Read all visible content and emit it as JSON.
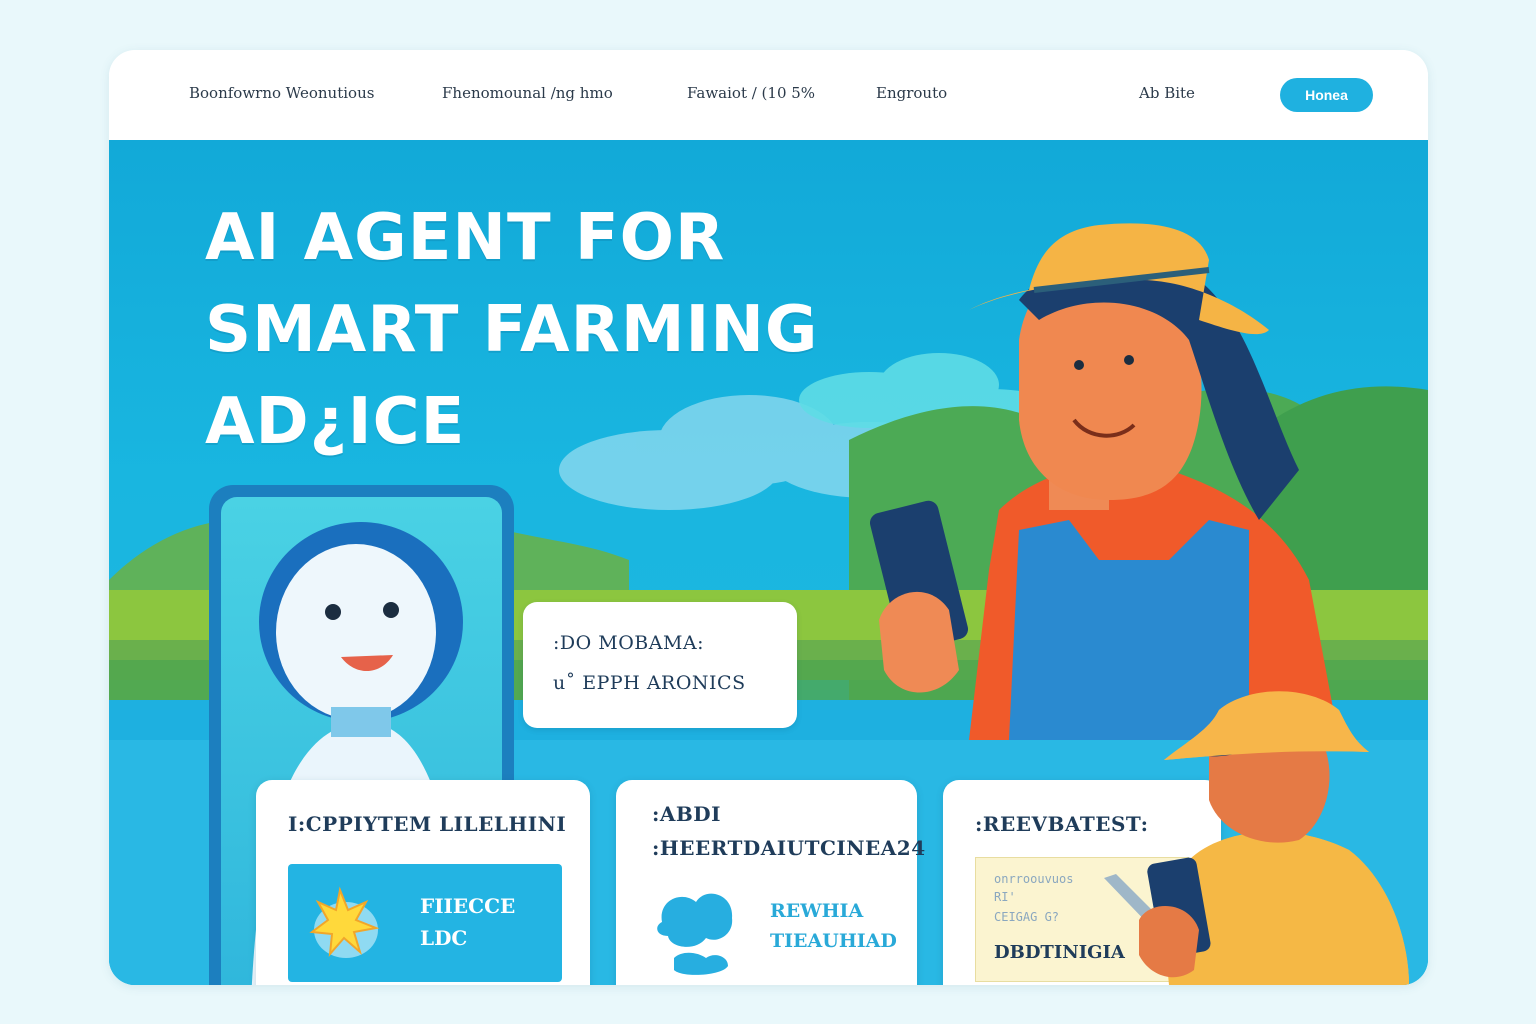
{
  "nav": {
    "links": [
      "Boonfowrno Weonutious",
      "Fhenomounal /ng hmo",
      "Fawaiot / (10 5%",
      "Engrouto"
    ],
    "secondary": "Ab Bite",
    "cta": "Honea"
  },
  "hero": {
    "title_lines": [
      "AI AGENT FOR",
      "SMART FARMING",
      "AD¿ICE"
    ]
  },
  "chat_bubble": {
    "lines": [
      ":DO MOBAMA:",
      "u˚ EPPH  ARONICS"
    ]
  },
  "cards": [
    {
      "title": "I:CPPIYTEM  LILELHINI",
      "panel_lines": [
        "FIIECCE",
        "LDC"
      ]
    },
    {
      "title_lines": [
        ":ABDI",
        ":HEERTDAIUTCINEA24"
      ],
      "lines": [
        "REWHIA",
        "TIEAUHIAD"
      ]
    },
    {
      "title": ":REEVBATEST:",
      "note_lines": [
        "onrroouvuos",
        "RI'",
        "CEIGAG  G?"
      ],
      "note_strong": "DBDTINIGIA"
    }
  ],
  "colors": {
    "accent": "#1fb1e0",
    "sky": "#19b6e0",
    "text_dark": "#1f3c5a"
  },
  "icons": [
    "robot-avatar-icon",
    "sun-icon",
    "cloud-icon",
    "pencil-icon"
  ]
}
